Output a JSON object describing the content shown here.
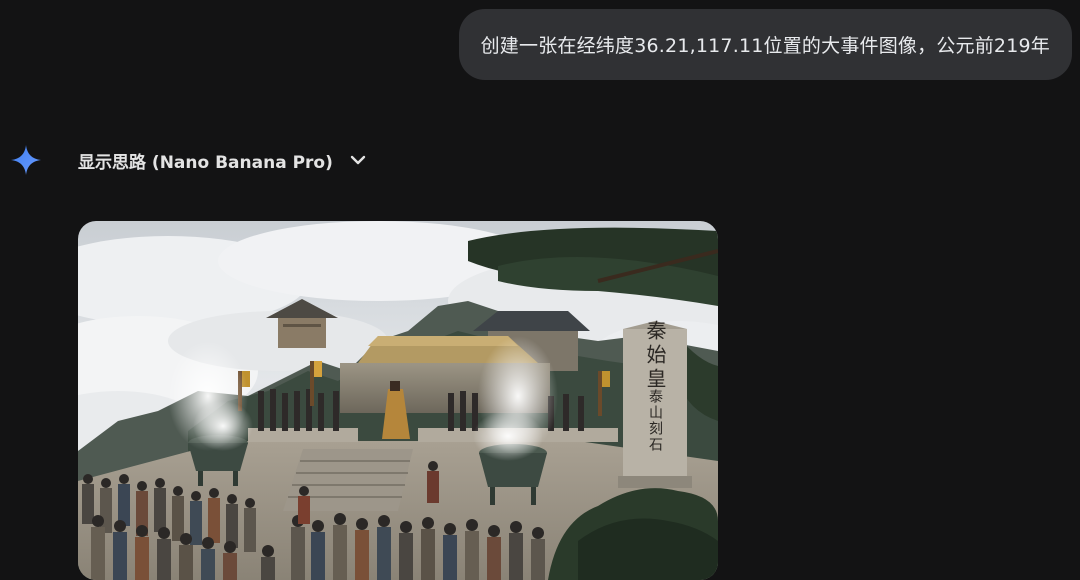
{
  "user_message": {
    "text": "创建一张在经纬度36.21,117.11位置的大事件图像，公元前219年"
  },
  "response": {
    "thinking_label": "显示思路 (Nano Banana Pro)",
    "image": {
      "stele_text_title": "秦始皇",
      "stele_text_sub": "泰山刻石"
    }
  },
  "colors": {
    "background": "#131314",
    "bubble": "#303134",
    "sparkle": "#4a8bf5"
  },
  "icons": [
    "gemini-sparkle-icon",
    "chevron-down-icon"
  ]
}
